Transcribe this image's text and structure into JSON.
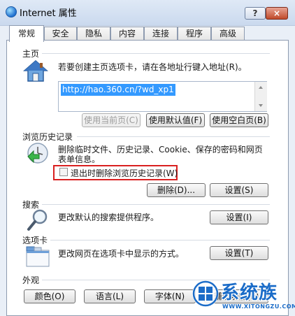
{
  "window": {
    "title": "Internet 属性",
    "help_label": "?",
    "close_label": "×"
  },
  "tabs": [
    "常规",
    "安全",
    "隐私",
    "内容",
    "连接",
    "程序",
    "高级"
  ],
  "homepage": {
    "section_label": "主页",
    "description": "若要创建主页选项卡，请在各地址行键入地址(R)。",
    "url_value": "http://hao.360.cn/?wd_xp1",
    "buttons": {
      "use_current": "使用当前页(C)",
      "use_default": "使用默认值(F)",
      "use_blank": "使用空白页(B)"
    }
  },
  "history": {
    "section_label": "浏览历史记录",
    "description_line1": "删除临时文件、历史记录、Cookie、保存的密码和网页",
    "description_line2": "表单信息。",
    "checkbox_label": "退出时删除浏览历史记录(W)",
    "checkbox_checked": false,
    "delete_button": "删除(D)...",
    "settings_button": "设置(S)"
  },
  "search": {
    "section_label": "搜索",
    "description": "更改默认的搜索提供程序。",
    "settings_button": "设置(I)"
  },
  "tabs_section": {
    "section_label": "选项卡",
    "description": "更改网页在选项卡中显示的方式。",
    "settings_button": "设置(T)"
  },
  "appearance": {
    "section_label": "外观",
    "buttons": {
      "colors": "颜色(O)",
      "languages": "语言(L)",
      "fonts": "字体(N)",
      "accessibility": "辅助功能(E)"
    }
  },
  "watermark": {
    "brand": "系统族",
    "url": "WWW.XITONGZU.COM"
  },
  "colors": {
    "accent": "#3399ff",
    "highlight_border": "#d92020",
    "watermark": "#1b6cc8"
  }
}
